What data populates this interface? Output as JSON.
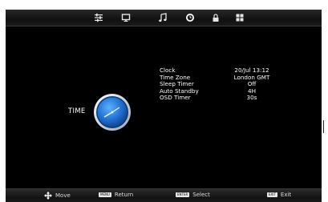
{
  "tabs": [
    {
      "icon": "sliders-icon"
    },
    {
      "icon": "monitor-icon"
    },
    {
      "icon": "music-note-icon"
    },
    {
      "icon": "clock-icon",
      "active": true
    },
    {
      "icon": "lock-icon"
    },
    {
      "icon": "grid-icon"
    }
  ],
  "section": {
    "title": "TIME"
  },
  "settings": [
    {
      "label": "Clock",
      "value": "20/Jul   13:12"
    },
    {
      "label": "Time Zone",
      "value": "London GMT"
    },
    {
      "label": "Sleep Timer",
      "value": "Off"
    },
    {
      "label": "Auto Standby",
      "value": "4H"
    },
    {
      "label": "OSD Timer",
      "value": "30s"
    }
  ],
  "footer": {
    "move": "Move",
    "return_key": "MENU",
    "return": "Return",
    "select_key": "ENTER",
    "select": "Select",
    "exit_key": "EXIT",
    "exit": "Exit"
  },
  "colors": {
    "accent": "#2f7fd4",
    "background": "#000000",
    "text": "#ffffff"
  }
}
